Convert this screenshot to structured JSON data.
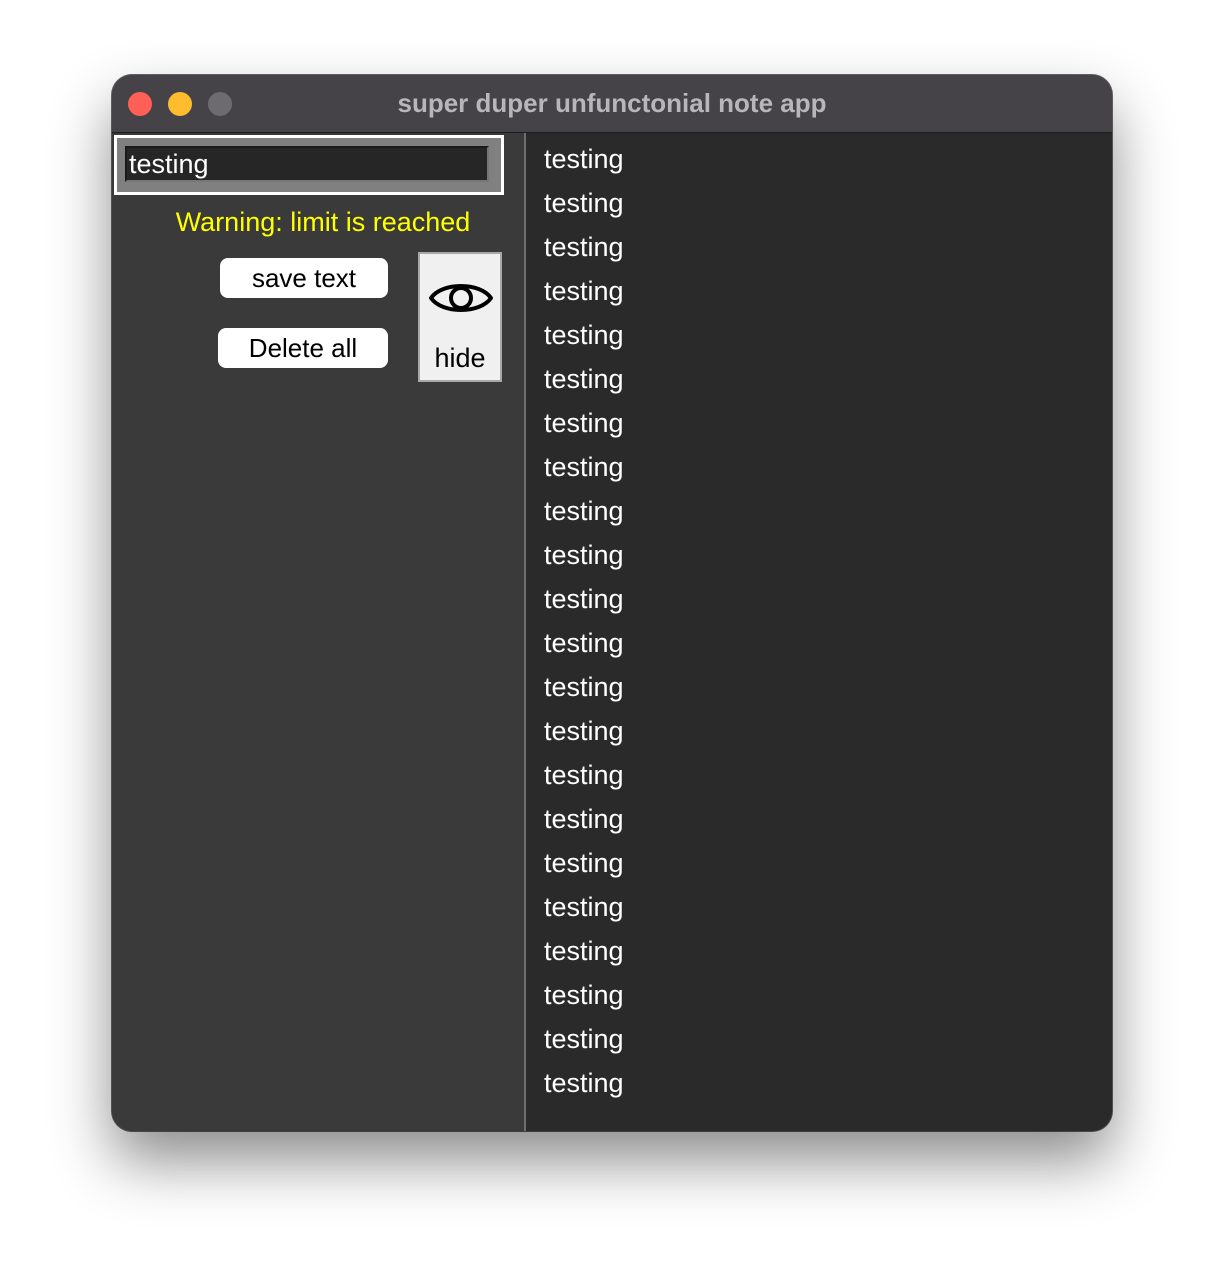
{
  "window": {
    "title": "super duper unfunctonial note app"
  },
  "editor": {
    "input_value": "testing",
    "warning": "Warning: limit is reached",
    "save_label": "save text",
    "delete_label": "Delete all",
    "hide_label": "hide",
    "hide_icon": "eye-icon"
  },
  "colors": {
    "warning": "#ffff00",
    "close": "#fe5f57",
    "minimize": "#febc2e",
    "maximize": "#6d6b70"
  },
  "notes": [
    "testing",
    "testing",
    "testing",
    "testing",
    "testing",
    "testing",
    "testing",
    "testing",
    "testing",
    "testing",
    "testing",
    "testing",
    "testing",
    "testing",
    "testing",
    "testing",
    "testing",
    "testing",
    "testing",
    "testing",
    "testing",
    "testing"
  ]
}
